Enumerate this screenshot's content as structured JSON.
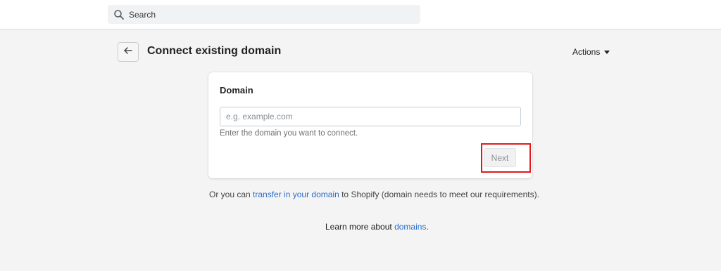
{
  "header": {
    "search_label": "Search"
  },
  "page": {
    "title": "Connect existing domain",
    "actions_label": "Actions"
  },
  "card": {
    "title": "Domain",
    "input_placeholder": "e.g. example.com",
    "input_value": "",
    "help_text": "Enter the domain you want to connect.",
    "next_label": "Next",
    "next_disabled": true
  },
  "footer": {
    "transfer_prefix": "Or you can ",
    "transfer_link": "transfer in your domain",
    "transfer_suffix": " to Shopify (domain needs to meet our requirements).",
    "learn_prefix": "Learn more about ",
    "learn_link": "domains",
    "learn_suffix": "."
  },
  "colors": {
    "link": "#2c6ecb",
    "highlight": "#e11a1a",
    "background": "#f4f4f4"
  },
  "icons": {
    "search": "search-icon",
    "back": "arrow-left-icon",
    "actions": "caret-down-icon"
  }
}
